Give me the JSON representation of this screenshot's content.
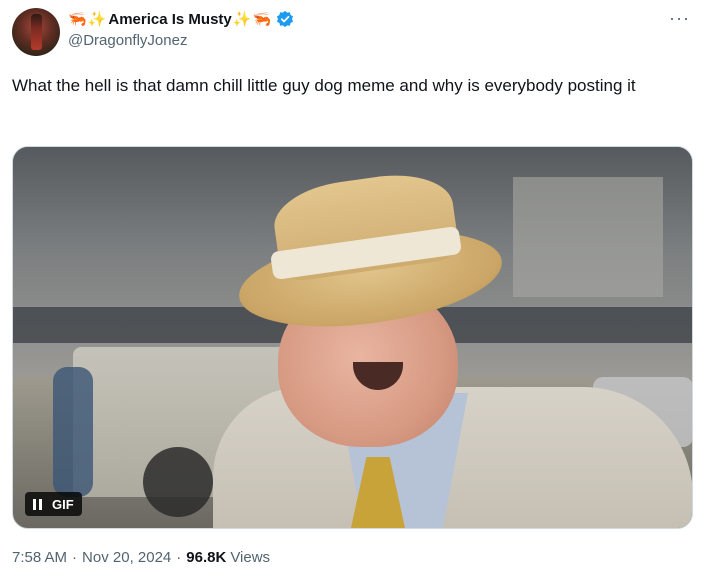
{
  "author": {
    "display_name": "America Is Musty",
    "handle": "@DragonflyJonez",
    "verified": true,
    "name_emojis_left": [
      "🦐",
      "✨"
    ],
    "name_emojis_right": [
      "✨",
      "🦐"
    ]
  },
  "tweet": {
    "text": "What the hell is that damn chill little guy dog meme and why is everybody posting it",
    "more_label": "···"
  },
  "media": {
    "badge_label": "GIF",
    "is_playing": true
  },
  "footer": {
    "time": "7:58 AM",
    "date": "Nov 20, 2024",
    "separator": "·",
    "views_count": "96.8K",
    "views_label": "Views"
  },
  "colors": {
    "verified_blue": "#1d9bf0",
    "secondary_text": "#536471",
    "primary_text": "#0f1419"
  }
}
